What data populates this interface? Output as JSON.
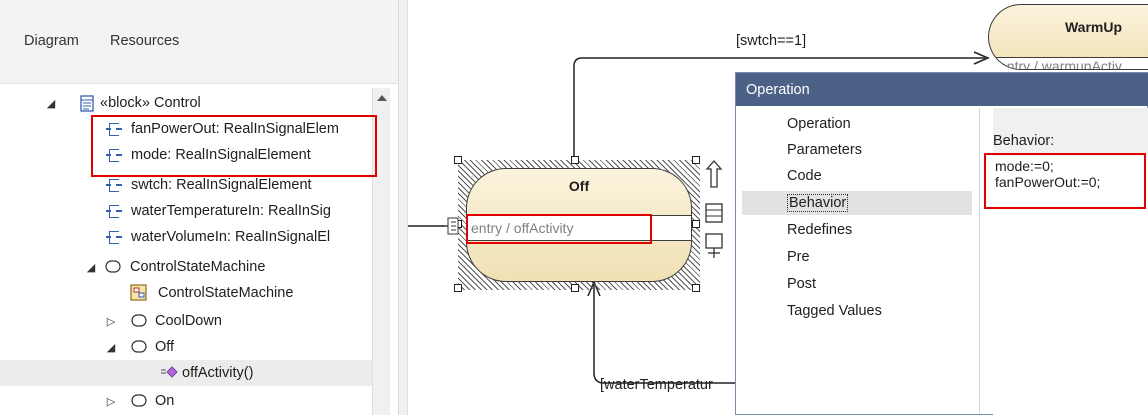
{
  "browser": {
    "tabs": [
      "Diagram",
      "Resources"
    ],
    "tree": [
      {
        "label": "«block» Control",
        "icon": "block-icon",
        "twisty": "expanded"
      },
      {
        "label": "fanPowerOut: RealInSignalElem",
        "icon": "signal-port-icon"
      },
      {
        "label": "mode: RealInSignalElement",
        "icon": "signal-port-icon"
      },
      {
        "label": "swtch: RealInSignalElement",
        "icon": "signal-port-icon"
      },
      {
        "label": "waterTemperatureIn: RealInSig",
        "icon": "signal-port-icon"
      },
      {
        "label": "waterVolumeIn: RealInSignalEl",
        "icon": "signal-port-icon"
      },
      {
        "label": "ControlStateMachine",
        "icon": "state-machine-icon",
        "twisty": "expanded"
      },
      {
        "label": "ControlStateMachine",
        "icon": "state-diagram-icon"
      },
      {
        "label": "CoolDown",
        "icon": "state-icon",
        "twisty": "collapsed"
      },
      {
        "label": "Off",
        "icon": "state-icon",
        "twisty": "expanded"
      },
      {
        "label": "offActivity()",
        "icon": "operation-icon"
      },
      {
        "label": "On",
        "icon": "state-icon",
        "twisty": "collapsed"
      }
    ]
  },
  "diagram": {
    "guard_top": "[swtch==1]",
    "guard_bottom": "[waterTemperatur",
    "state_off": {
      "name": "Off",
      "activity": "entry / offActivity"
    },
    "state_warmup": {
      "name": "WarmUp",
      "activity": "entry / warmupActiv"
    }
  },
  "dialog": {
    "title": "Operation",
    "nav": [
      "Operation",
      "Parameters",
      "Code",
      "Behavior",
      "Redefines",
      "Pre",
      "Post",
      "Tagged Values"
    ],
    "selected_nav": "Behavior",
    "behavior_label": "Behavior:",
    "behavior_code": [
      "mode:=0;",
      "fanPowerOut:=0;"
    ]
  },
  "colors": {
    "highlight": "#e00000",
    "dialog_title": "#4c6186",
    "state_fill": "#f4e6c0"
  }
}
